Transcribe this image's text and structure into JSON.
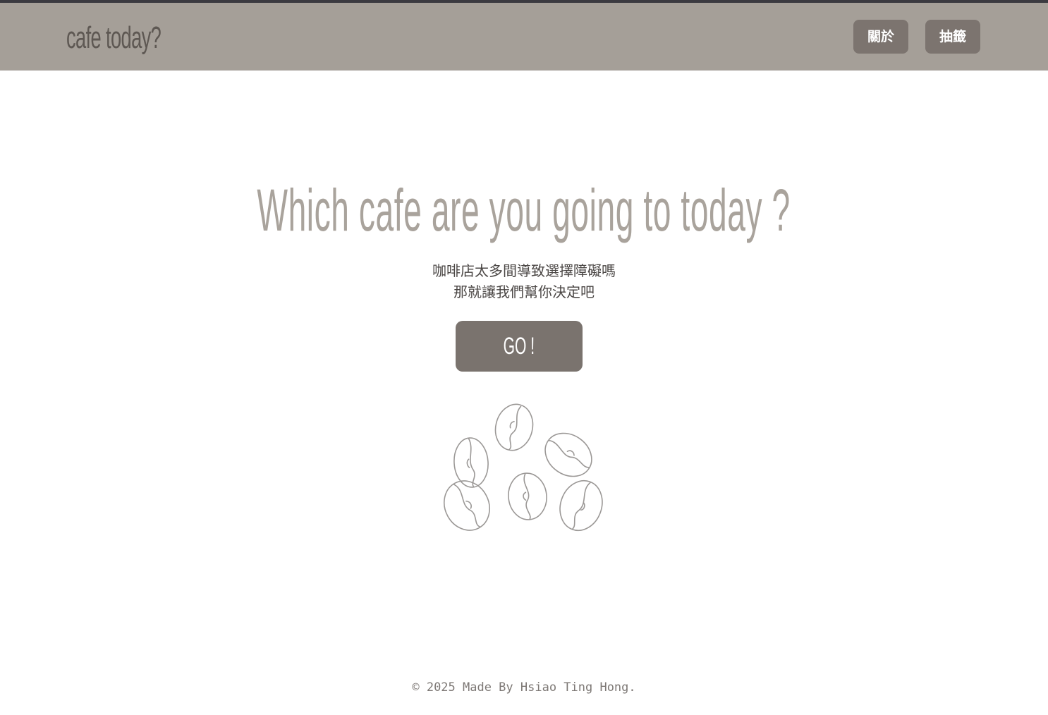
{
  "navbar": {
    "brand": "cafe today?",
    "about_label": "關於",
    "draw_label": "抽籤"
  },
  "hero": {
    "title": "Which cafe are you going to today ?",
    "subtitle_line1": "咖啡店太多間導致選擇障礙嗎",
    "subtitle_line2": "那就讓我們幫你決定吧",
    "go_label": "GO !"
  },
  "illustration": {
    "icon": "coffee-beans-icon"
  },
  "footer": {
    "text": "© 2025 Made By Hsiao Ting Hong."
  },
  "colors": {
    "navbar_bg": "#a59f98",
    "button_bg": "#7c746f",
    "title_color": "#a9a39c",
    "brand_color": "#5e5853"
  }
}
